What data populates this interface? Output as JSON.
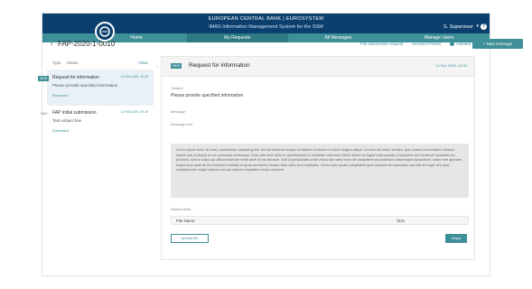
{
  "header": {
    "bank_title": "EUROPEAN CENTRAL BANK | EUROSYSTEM",
    "system_title": "IMAS Information Management System for the SSM",
    "user": "S. Supervisor",
    "help": "?"
  },
  "nav": {
    "items": [
      "Home",
      "My Requests",
      "All Messages",
      "Manage Users"
    ],
    "active_index": 1
  },
  "subheader": {
    "back": "‹",
    "reference": "FAP-2020-1-0010",
    "link_details": "Full submission request",
    "link_archive": "Involved Parties",
    "link_status": "Initiated",
    "new_message": "+ New message"
  },
  "filters": {
    "type": "Type",
    "status": "Status",
    "clear": "Clear"
  },
  "messages": [
    {
      "badge": "NEW",
      "title": "Request for information",
      "date": "14 Feb 2020, 10:30",
      "body": "Please provide specified information",
      "status": "Received"
    },
    {
      "badge": "OUT",
      "title": "FAP initial submission",
      "date": "12 Feb 2020, 09:15",
      "body": "Test subject line",
      "status": "Submitted"
    }
  ],
  "detail": {
    "badge": "NEW",
    "title": "Request for information",
    "date": "14 Feb 2020, 10:30",
    "subject_label": "Subject",
    "subject_value": "Please provide specified information",
    "message_label": "Message",
    "message_sub_label": "Message text",
    "message_text": "Lorem ipsum dolor sit amet, consectetur adipiscing elit, sed do eiusmod tempor incididunt ut labore et dolore magna aliqua. Ut enim ad minim veniam, quis nostrud exercitation ullamco laboris nisi ut aliquip ex ea commodo consequat. Duis aute irure dolor in reprehenderit in voluptate velit esse cillum dolore eu fugiat nulla pariatur. Excepteur sint occaecat cupidatat non proident, sunt in culpa qui officia deserunt mollit anim id est laborum. Sed ut perspiciatis unde omnis iste natus error sit voluptatem accusantium doloremque laudantium, totam rem aperiam, eaque ipsa quae ab illo inventore veritatis et quasi architecto beatae vitae dicta sunt explicabo. Nemo enim ipsam voluptatem quia voluptas sit aspernatur aut odit aut fugit, sed quia consequuntur magni dolores eos qui ratione voluptatem sequi nesciunt.",
    "attachments_label": "Attachments",
    "col_file_name": "File Name",
    "col_size": "Size",
    "upload_button": "Upload file",
    "reply_button": "Reply"
  },
  "colors": {
    "brand_dark": "#0b3f6e",
    "accent": "#3f8f98"
  }
}
